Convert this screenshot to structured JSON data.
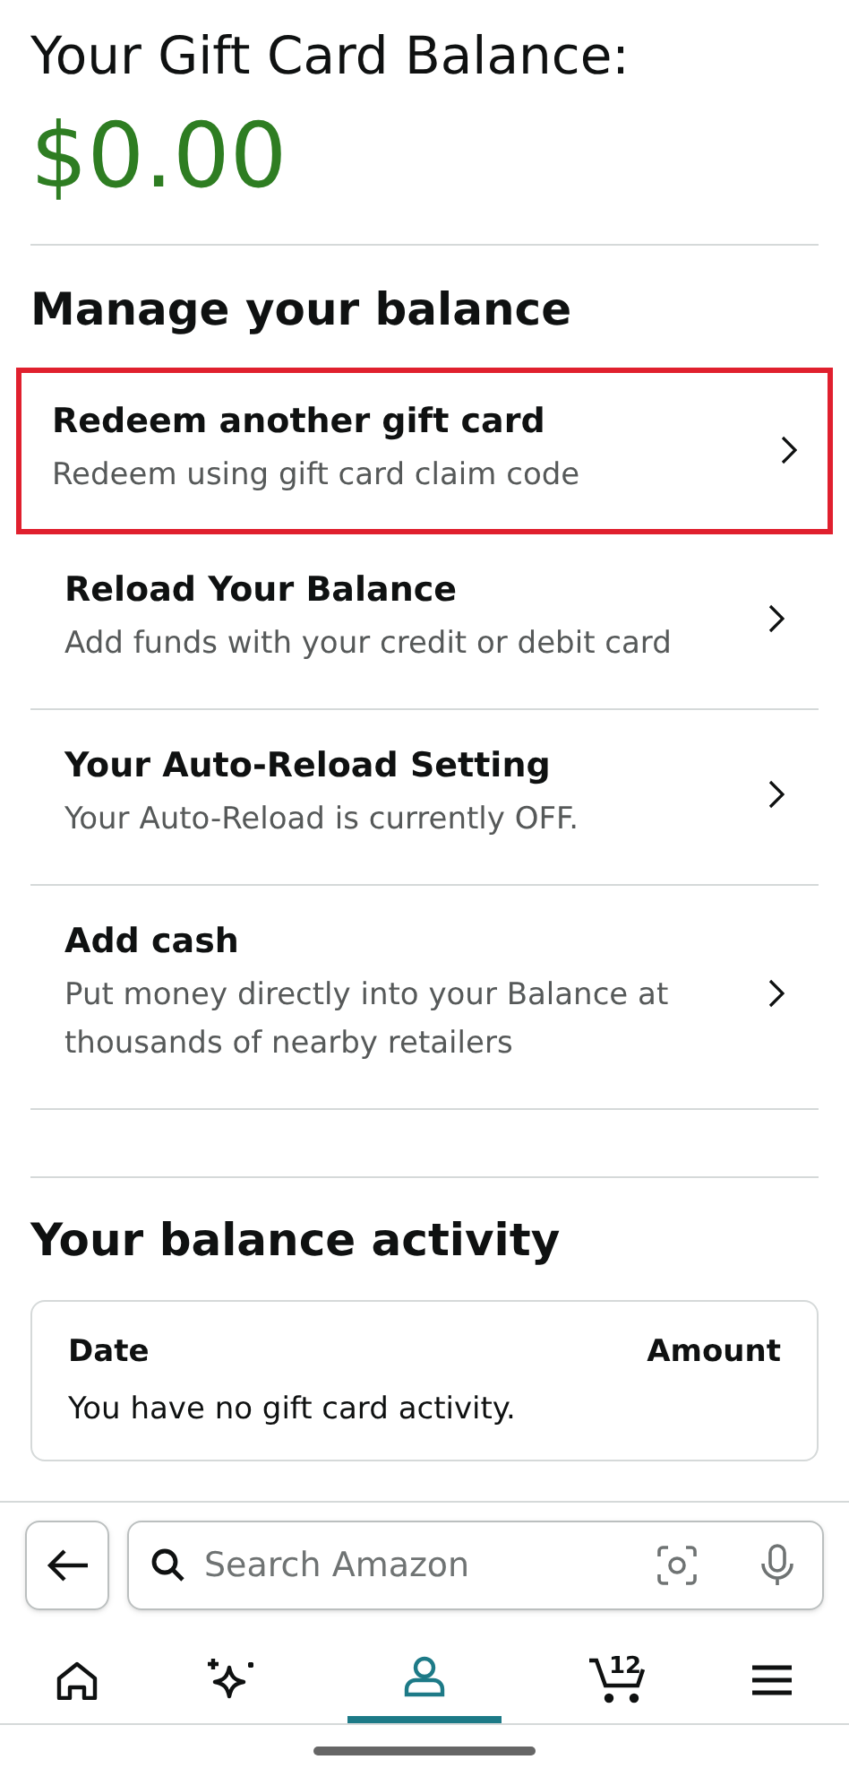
{
  "balance": {
    "title": "Your Gift Card Balance:",
    "amount": "$0.00"
  },
  "manage": {
    "heading": "Manage your balance",
    "items": [
      {
        "title": "Redeem another gift card",
        "subtitle": "Redeem using gift card claim code",
        "highlighted": true
      },
      {
        "title": "Reload Your Balance",
        "subtitle": "Add funds with your credit or debit card",
        "highlighted": false
      },
      {
        "title": "Your Auto-Reload Setting",
        "subtitle": "Your Auto-Reload is currently OFF.",
        "highlighted": false
      },
      {
        "title": "Add cash",
        "subtitle": "Put money directly into your Balance at thousands of nearby retailers",
        "highlighted": false
      }
    ]
  },
  "activity": {
    "heading": "Your balance activity",
    "columns": [
      "Date",
      "Amount"
    ],
    "empty_message": "You have no gift card activity."
  },
  "search": {
    "placeholder": "Search Amazon"
  },
  "nav": [
    {
      "kind": "home",
      "selected": false
    },
    {
      "kind": "sparkle",
      "selected": false
    },
    {
      "kind": "account",
      "selected": true
    },
    {
      "kind": "cart",
      "selected": false,
      "badge": "12"
    },
    {
      "kind": "menu",
      "selected": false
    }
  ]
}
